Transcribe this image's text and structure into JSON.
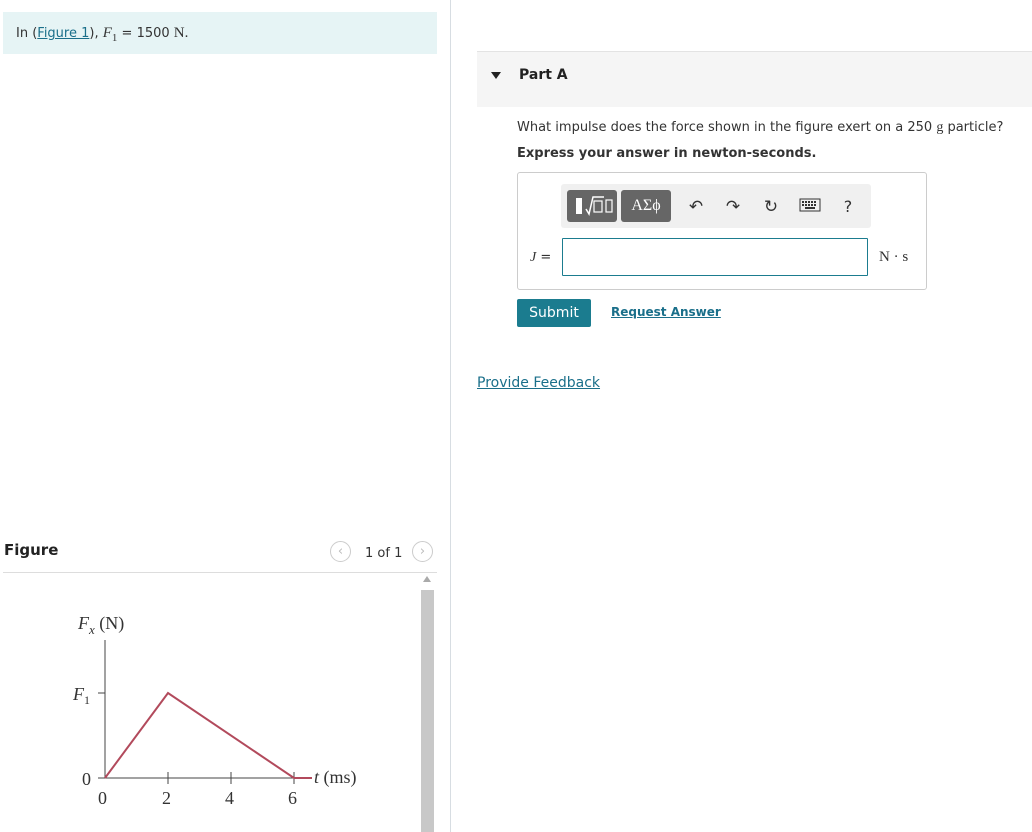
{
  "intro": {
    "prefix": "In (",
    "figure_link": "Figure 1",
    "suffix": "), ",
    "variable": "F",
    "subscript": "1",
    "equals": " = 1500 ",
    "unit": "N."
  },
  "figure": {
    "title": "Figure",
    "pager": "1 of 1",
    "prev_icon": "chevron-left-icon",
    "next_icon": "chevron-right-icon"
  },
  "chart_data": {
    "type": "line",
    "title": "",
    "ylabel": "F_x (N)",
    "xlabel": "t (ms)",
    "x_ticks": [
      "0",
      "2",
      "4",
      "6"
    ],
    "y_ticks": [
      "0",
      "F1"
    ],
    "series": [
      {
        "x": [
          0,
          2,
          6
        ],
        "y": [
          "0",
          "F1",
          "0"
        ]
      }
    ],
    "line_color": "#b24a5c"
  },
  "part": {
    "title": "Part A",
    "question_prefix": "What impulse does the force shown in the figure exert on a 250 ",
    "question_unit": "g",
    "question_suffix": " particle?",
    "instruction": "Express your answer in newton-seconds."
  },
  "toolbar": {
    "templates_icon": "fraction-sqrt-template-icon",
    "symbols_label": "ΑΣϕ",
    "undo_icon": "undo-icon",
    "redo_icon": "redo-icon",
    "reset_icon": "reset-icon",
    "keyboard_icon": "keyboard-icon",
    "help_label": "?"
  },
  "answer": {
    "variable": "J",
    "equals": " =",
    "value": "",
    "unit": "N · s"
  },
  "actions": {
    "submit": "Submit",
    "request_answer": "Request Answer"
  },
  "feedback_link": "Provide Feedback"
}
